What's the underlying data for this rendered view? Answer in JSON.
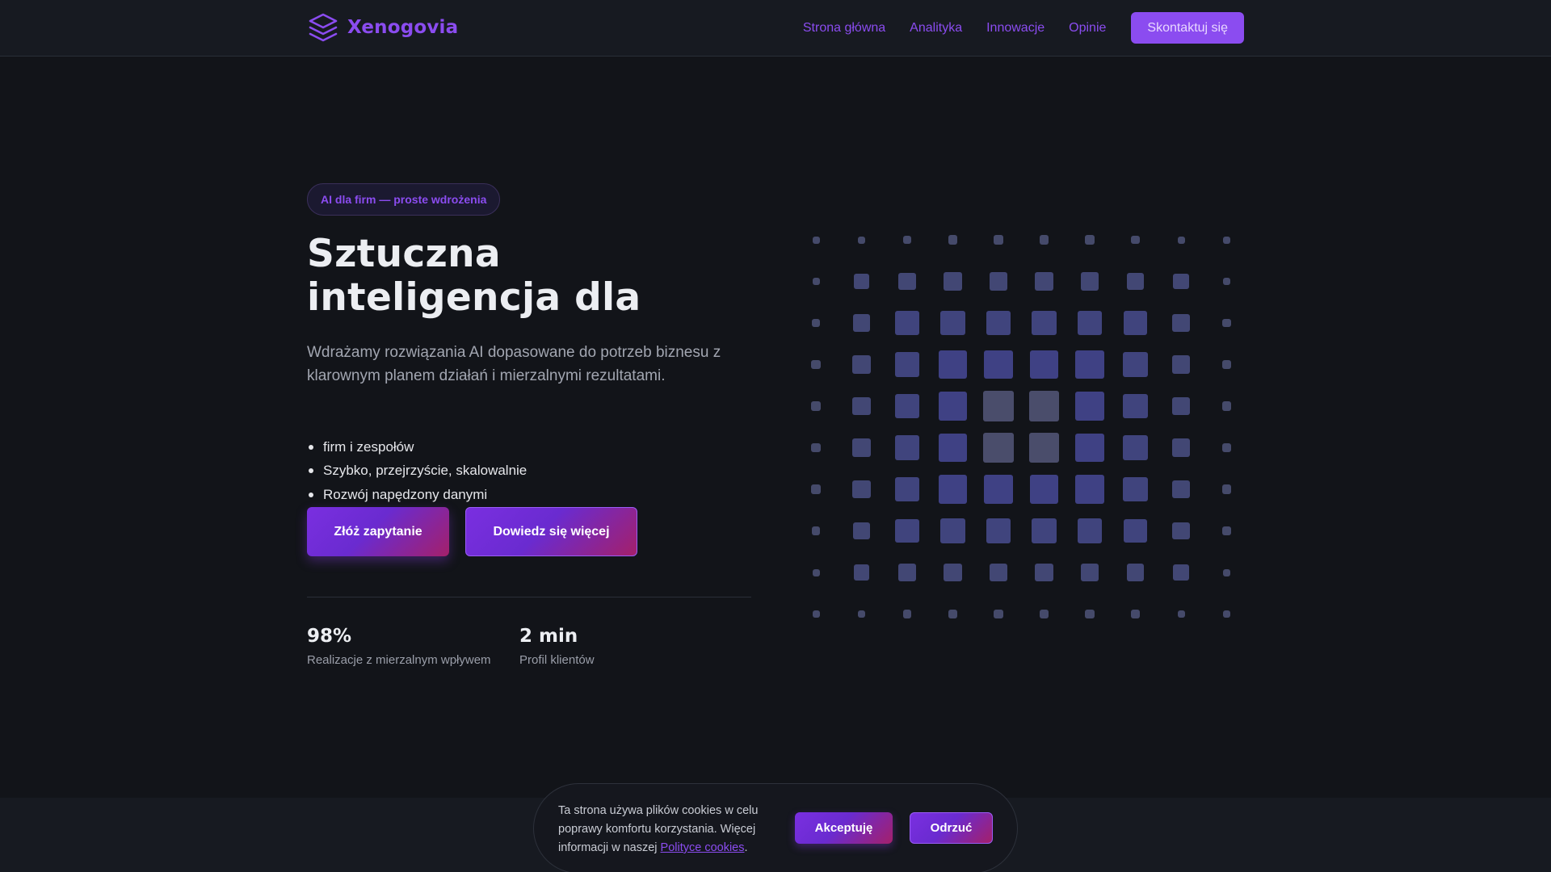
{
  "brand": {
    "name": "Xenogovia",
    "accent": "#8b4cf0",
    "icon": "stacked-layers-icon"
  },
  "nav": {
    "items": [
      {
        "label": "Strona główna"
      },
      {
        "label": "Analityka"
      },
      {
        "label": "Innowacje"
      },
      {
        "label": "Opinie"
      }
    ],
    "cta_label": "Skontaktuj się"
  },
  "hero": {
    "badge": "AI dla firm — proste wdrożenia",
    "title": "Sztuczna inteligencja dla",
    "subtitle": "Wdrażamy rozwiązania AI dopasowane do potrzeb biznesu z klarownym planem działań i mierzalnymi rezultatami.",
    "features": [
      "firm i zespołów",
      "Szybko, przejrzyście, skalowalnie",
      "Rozwój napędzony danymi"
    ],
    "primary_button": "Złóż zapytanie",
    "secondary_button": "Dowiedz się więcej",
    "stats": [
      {
        "value": "98%",
        "label": "Realizacje z mierzalnym wpływem"
      },
      {
        "value": "2 min",
        "label": "Profil klientów"
      }
    ]
  },
  "visual": {
    "rows": 10,
    "cols": 10,
    "colors": {
      "edge": "#454a6a",
      "center": "#3d3f8a",
      "highlight": "#4a4d6b"
    }
  },
  "cookie": {
    "text_before": "Ta strona używa plików cookies w celu poprawy komfortu korzystania. Więcej informacji w naszej",
    "link_label": "Polityce cookies",
    "text_after": ".",
    "accept_label": "Akceptuję",
    "reject_label": "Odrzuć"
  }
}
